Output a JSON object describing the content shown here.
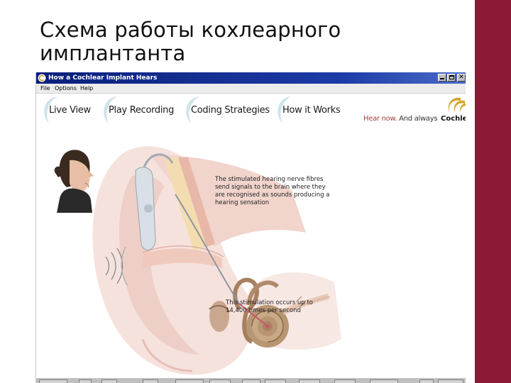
{
  "slide": {
    "title": "Схема работы кохлеарного имплантанта"
  },
  "window": {
    "title": "How a Cochlear Implant Hears",
    "close_glyph": "✕"
  },
  "menu": {
    "items": [
      {
        "label": "File"
      },
      {
        "label": "Options"
      },
      {
        "label": "Help"
      }
    ]
  },
  "nav": {
    "tabs": [
      {
        "label": "Live View"
      },
      {
        "label": "Play Recording"
      },
      {
        "label": "Coding Strategies"
      },
      {
        "label": "How it Works"
      }
    ]
  },
  "brand": {
    "tagline_hear": "Hear now.",
    "tagline_always": "And always",
    "name": "Cochlea"
  },
  "captions": {
    "nerve": "The stimulated hearing nerve fibres send signals to the brain where they are recognised as sounds producing a hearing sensation",
    "stimulation": "This stimulation occurs up to 14,400 times per second"
  },
  "colors": {
    "accent_bar": "#8c1a36",
    "title_bar": "#0a1f7a",
    "tab_swoosh": "#cfe3ea"
  }
}
